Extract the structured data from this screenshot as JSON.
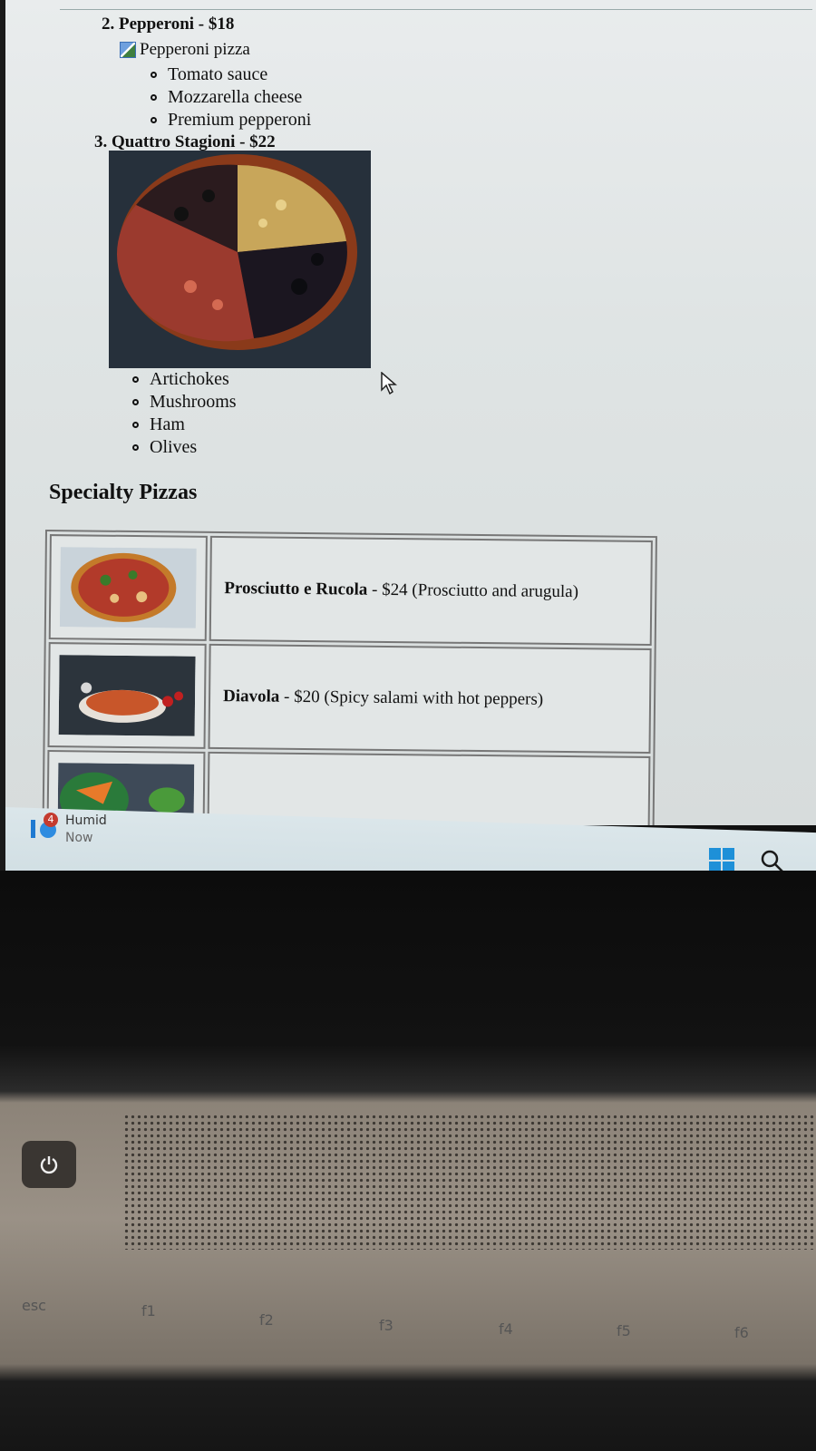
{
  "menu": {
    "item2": {
      "title": "2. Pepperoni - $18",
      "image_alt": "Pepperoni pizza",
      "toppings": [
        "Tomato sauce",
        "Mozzarella cheese",
        "Premium pepperoni"
      ]
    },
    "item3": {
      "title": "3. Quattro Stagioni - $22",
      "toppings": [
        "Artichokes",
        "Mushrooms",
        "Ham",
        "Olives"
      ]
    }
  },
  "specialty": {
    "heading": "Specialty Pizzas",
    "rows": [
      {
        "name": "Prosciutto e Rucola",
        "rest": " - $24 (Prosciutto and arugula)"
      },
      {
        "name": "Diavola",
        "rest": " - $20 (Spicy salami with hot peppers)"
      },
      {
        "name": "",
        "rest": ""
      }
    ]
  },
  "taskbar": {
    "weather_badge": "4",
    "weather_label": "Humid",
    "weather_sub": "Now",
    "icons": [
      "weather-icon",
      "windows-start-icon",
      "search-icon"
    ]
  },
  "keyboard": {
    "keys": [
      "esc",
      "f1",
      "f2",
      "f3",
      "f4",
      "f5",
      "f6"
    ]
  },
  "colors": {
    "accent": "#1e90d8",
    "badge": "#c43b2f"
  }
}
